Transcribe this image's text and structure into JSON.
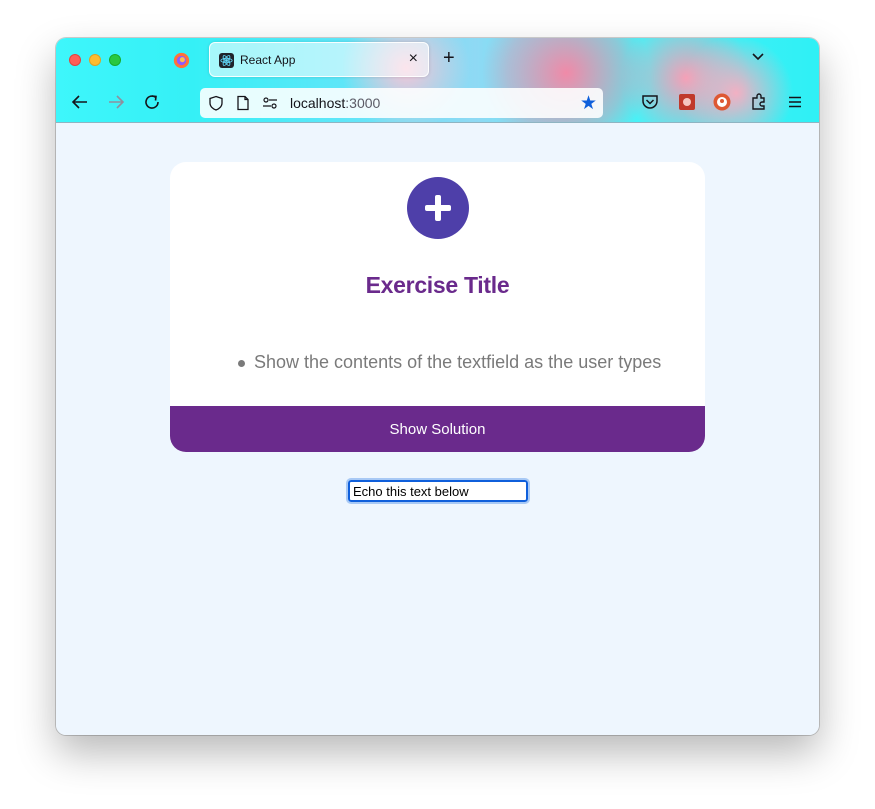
{
  "browser": {
    "tab_title": "React App",
    "tab_close_glyph": "×",
    "new_tab_glyph": "+",
    "url_host": "localhost",
    "url_port": ":3000",
    "bookmark_glyph": "★"
  },
  "exercise": {
    "title": "Exercise Title",
    "requirements": [
      "Show the contents of the textfield as the user types"
    ],
    "solution_button_label": "Show Solution"
  },
  "echo": {
    "value": "Echo this text below"
  },
  "colors": {
    "accent_purple": "#6a2a8c",
    "add_button": "#4e3fa9",
    "page_background": "#eef6fe",
    "bookmark_blue": "#0f5fdb"
  }
}
